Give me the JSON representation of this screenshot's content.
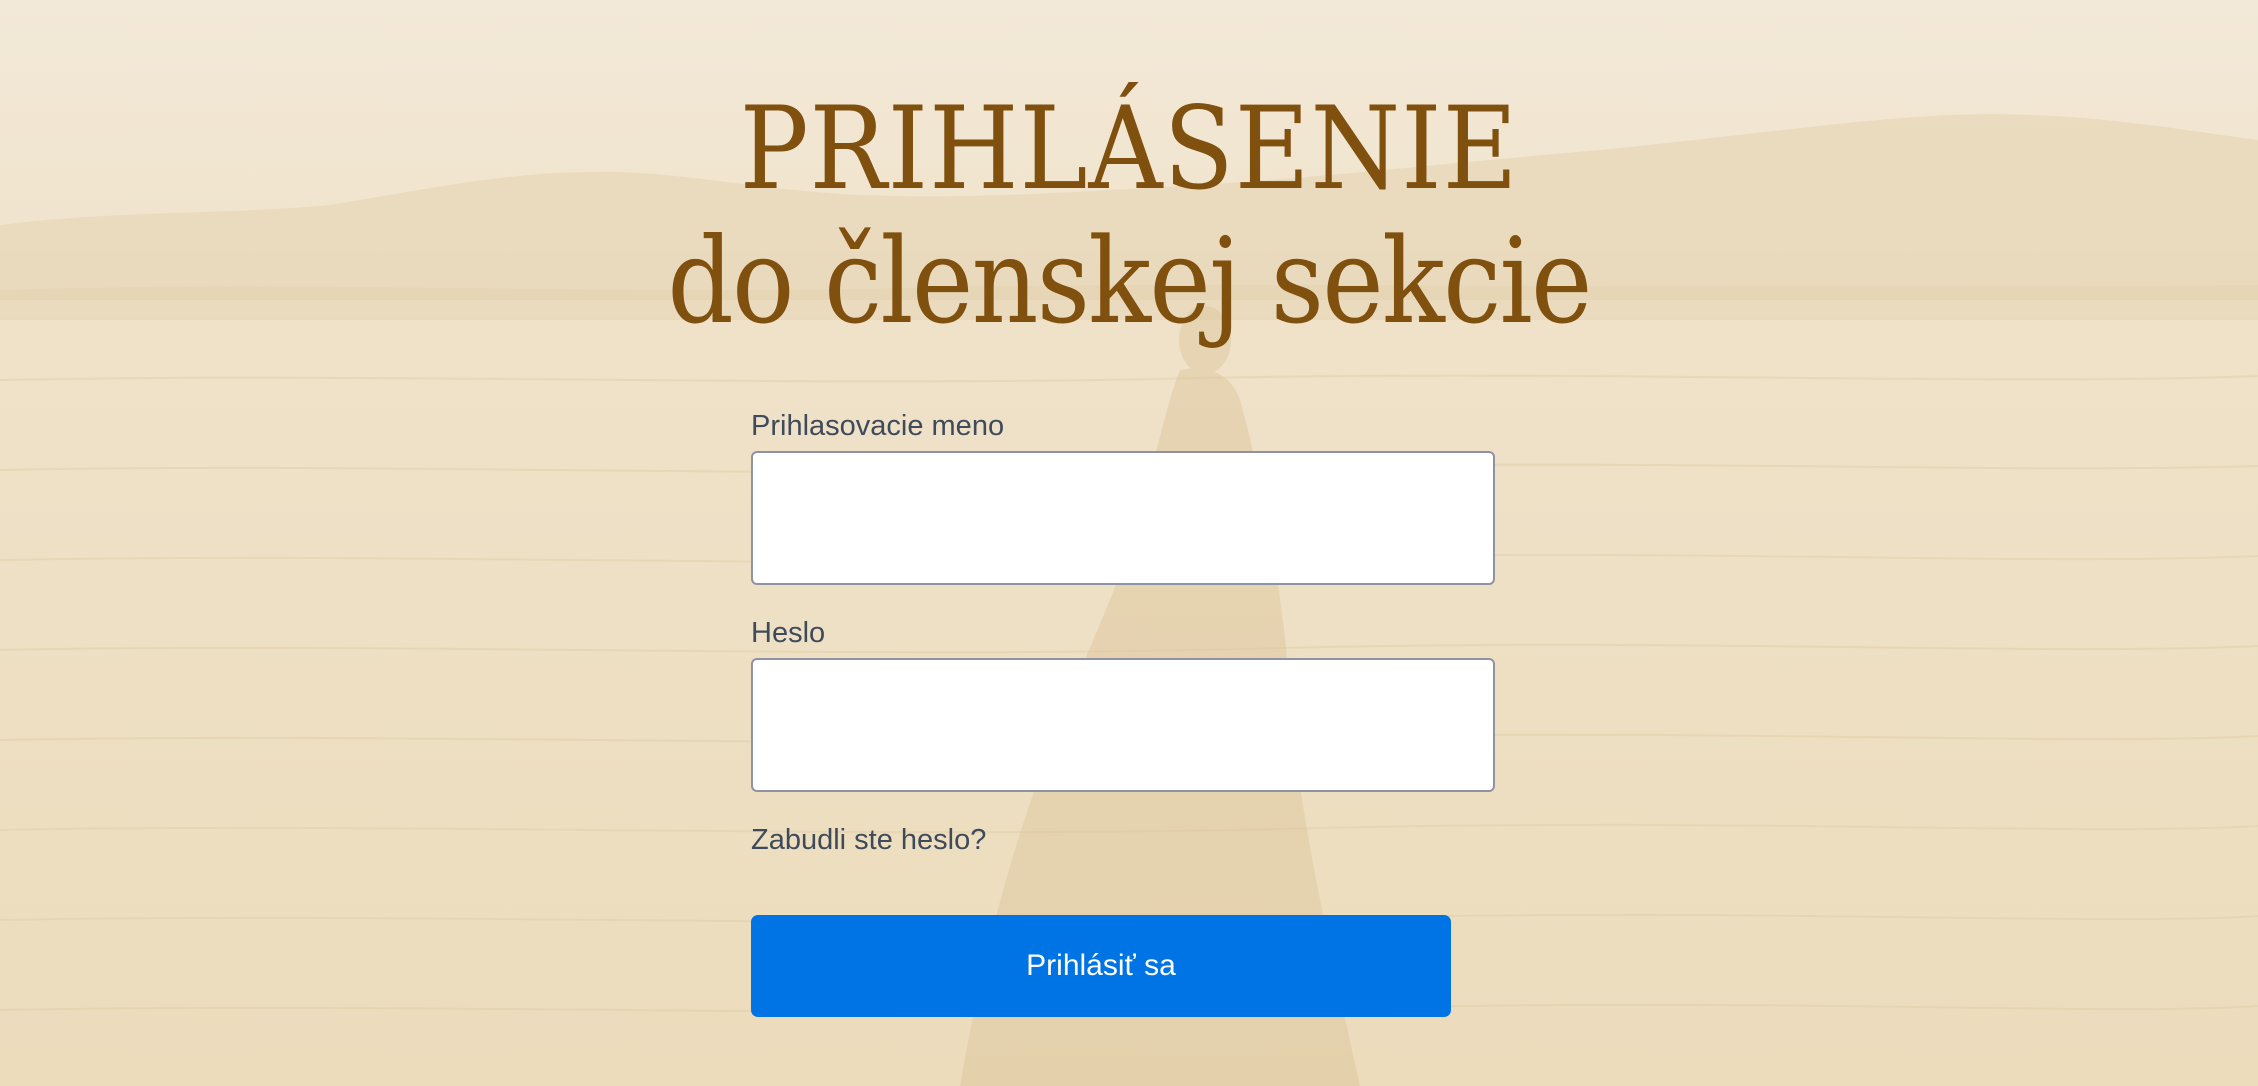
{
  "heading": {
    "line1": "PRIHLÁSENIE",
    "line2": "do členskej sekcie"
  },
  "form": {
    "username": {
      "label": "Prihlasovacie meno",
      "value": ""
    },
    "password": {
      "label": "Heslo",
      "value": ""
    },
    "forgot_link": "Zabudli ste heslo?",
    "submit_label": "Prihlásiť sa"
  },
  "colors": {
    "heading": "#80500e",
    "label_text": "#3f4a5a",
    "button_bg": "#0074e4",
    "button_text": "#ffffff",
    "background": "#efe3cc"
  }
}
